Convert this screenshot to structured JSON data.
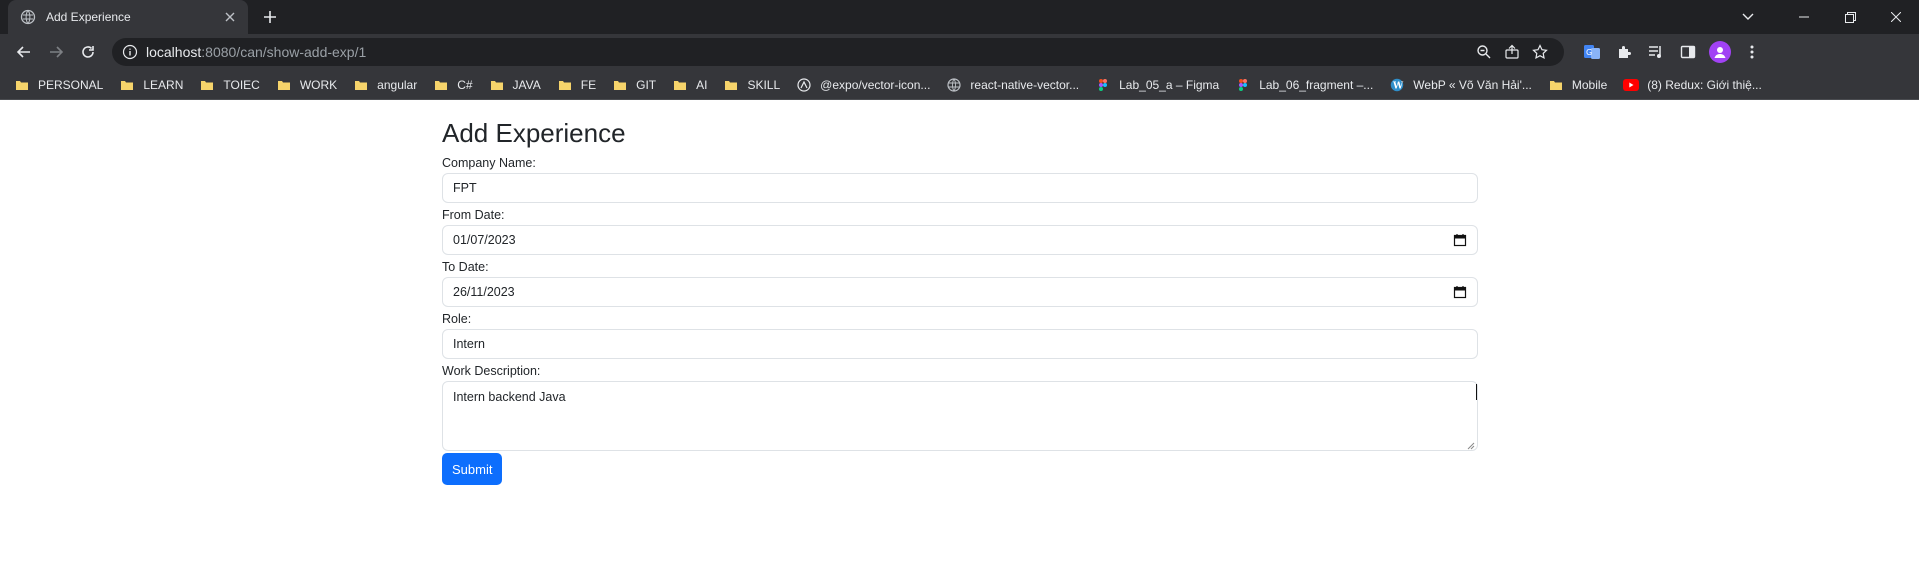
{
  "browser": {
    "tab": {
      "title": "Add Experience"
    },
    "url": {
      "host": "localhost",
      "rest": ":8080/can/show-add-exp/1"
    },
    "bookmarks": [
      {
        "label": "PERSONAL",
        "icon": "folder-icon"
      },
      {
        "label": "LEARN",
        "icon": "folder-icon"
      },
      {
        "label": "TOIEC",
        "icon": "folder-icon"
      },
      {
        "label": "WORK",
        "icon": "folder-icon"
      },
      {
        "label": "angular",
        "icon": "folder-icon"
      },
      {
        "label": "C#",
        "icon": "folder-icon"
      },
      {
        "label": "JAVA",
        "icon": "folder-icon"
      },
      {
        "label": "FE",
        "icon": "folder-icon"
      },
      {
        "label": "GIT",
        "icon": "folder-icon"
      },
      {
        "label": "AI",
        "icon": "folder-icon"
      },
      {
        "label": "SKILL",
        "icon": "folder-icon"
      },
      {
        "label": "@expo/vector-icon...",
        "icon": "expo-icon"
      },
      {
        "label": "react-native-vector...",
        "icon": "globe-icon"
      },
      {
        "label": "Lab_05_a – Figma",
        "icon": "figma-icon"
      },
      {
        "label": "Lab_06_fragment –...",
        "icon": "figma-icon"
      },
      {
        "label": "WebP « Võ Văn Hải'...",
        "icon": "wordpress-icon"
      },
      {
        "label": "Mobile",
        "icon": "folder-icon"
      },
      {
        "label": "(8) Redux: Giới thiệ...",
        "icon": "youtube-icon"
      }
    ],
    "colors": {
      "chrome_dark": "#202124",
      "toolbar": "#35363a",
      "folder": "#f6d46b"
    }
  },
  "form": {
    "title": "Add Experience",
    "company": {
      "label": "Company Name:",
      "value": "FPT"
    },
    "from_date": {
      "label": "From Date:",
      "value": "01/07/2023"
    },
    "to_date": {
      "label": "To Date:",
      "value": "26/11/2023"
    },
    "role": {
      "label": "Role:",
      "value": "Intern"
    },
    "description": {
      "label": "Work Description:",
      "value": "Intern backend Java"
    },
    "submit_label": "Submit",
    "colors": {
      "primary": "#0d6efd",
      "border": "#dee2e6",
      "text": "#212529"
    }
  }
}
